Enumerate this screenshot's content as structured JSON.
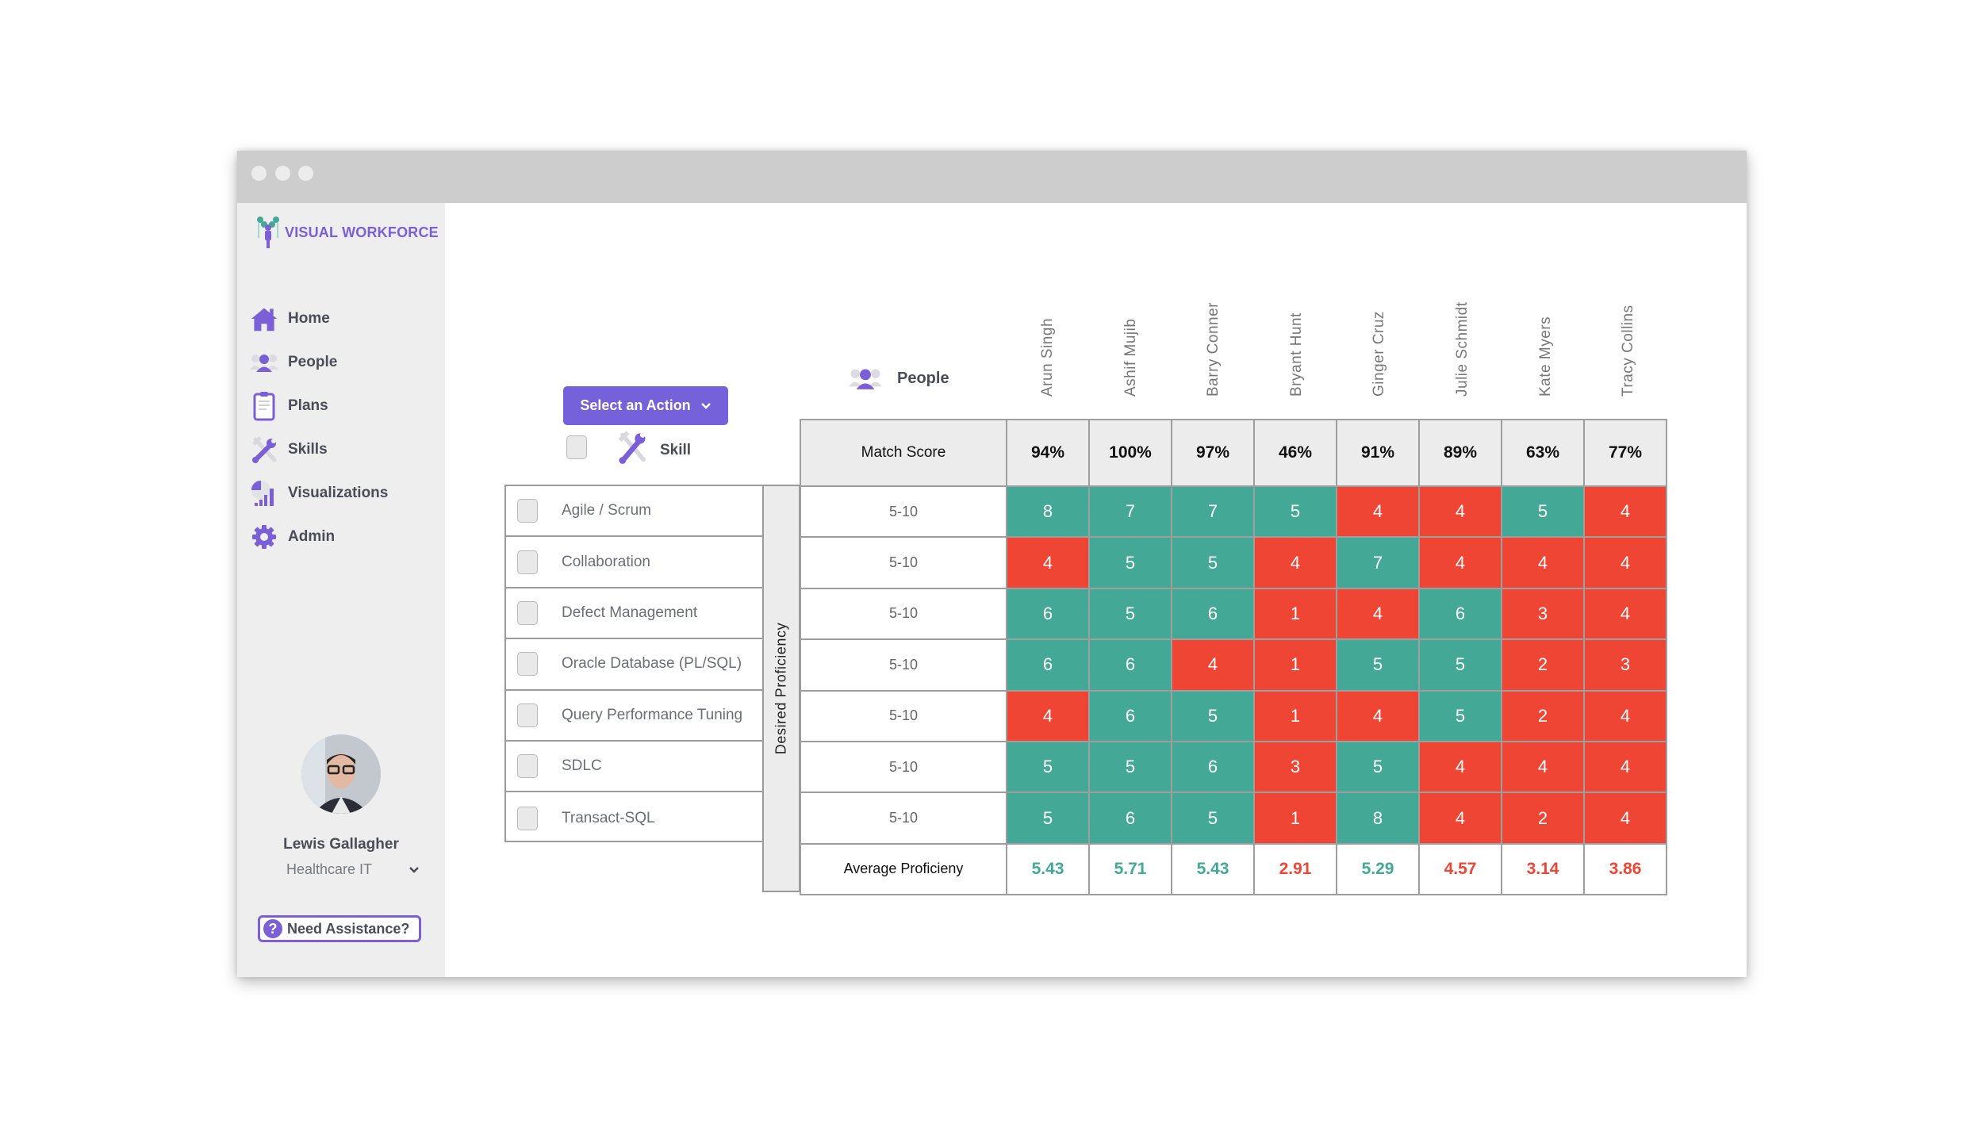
{
  "window": {
    "controls": [
      "close",
      "minimize",
      "maximize"
    ]
  },
  "brand": {
    "name": "VISUAL WORKFORCE",
    "accent": "#7a5fd6"
  },
  "sidebar": {
    "items": [
      {
        "label": "Home",
        "icon": "home-icon"
      },
      {
        "label": "People",
        "icon": "people-icon"
      },
      {
        "label": "Plans",
        "icon": "clipboard-icon"
      },
      {
        "label": "Skills",
        "icon": "tools-icon"
      },
      {
        "label": "Visualizations",
        "icon": "chart-icon"
      },
      {
        "label": "Admin",
        "icon": "gear-icon"
      }
    ],
    "user": {
      "name": "Lewis Gallagher",
      "org": "Healthcare IT"
    },
    "assist_label": "Need Assistance?"
  },
  "toolbar": {
    "action_label": "Select an Action"
  },
  "headers": {
    "skill": "Skill",
    "people": "People",
    "match_score": "Match Score",
    "desired_proficiency": "Desired Proficiency",
    "average": "Average Proficieny"
  },
  "colors": {
    "meets": "#44a896",
    "below": "#ef4535"
  },
  "people": [
    "Arun Singh",
    "Ashif Mujib",
    "Barry Conner",
    "Bryant Hunt",
    "Ginger Cruz",
    "Julie Schmidt",
    "Kate Myers",
    "Tracy Collins"
  ],
  "match_scores": [
    "94%",
    "100%",
    "97%",
    "46%",
    "91%",
    "89%",
    "63%",
    "77%"
  ],
  "skills": [
    {
      "name": "Agile / Scrum",
      "desired": "5-10",
      "scores": [
        8,
        7,
        7,
        5,
        4,
        4,
        5,
        4
      ]
    },
    {
      "name": "Collaboration",
      "desired": "5-10",
      "scores": [
        4,
        5,
        5,
        4,
        7,
        4,
        4,
        4
      ]
    },
    {
      "name": "Defect Management",
      "desired": "5-10",
      "scores": [
        6,
        5,
        6,
        1,
        4,
        6,
        3,
        4
      ]
    },
    {
      "name": "Oracle Database (PL/SQL)",
      "desired": "5-10",
      "scores": [
        6,
        6,
        4,
        1,
        5,
        5,
        2,
        3
      ]
    },
    {
      "name": "Query Performance Tuning",
      "desired": "5-10",
      "scores": [
        4,
        6,
        5,
        1,
        4,
        5,
        2,
        4
      ]
    },
    {
      "name": "SDLC",
      "desired": "5-10",
      "scores": [
        5,
        5,
        6,
        3,
        5,
        4,
        4,
        4
      ]
    },
    {
      "name": "Transact-SQL",
      "desired": "5-10",
      "scores": [
        5,
        6,
        5,
        1,
        8,
        4,
        2,
        4
      ]
    }
  ],
  "averages": [
    "5.43",
    "5.71",
    "5.43",
    "2.91",
    "5.29",
    "4.57",
    "3.14",
    "3.86"
  ],
  "threshold_min": 5
}
